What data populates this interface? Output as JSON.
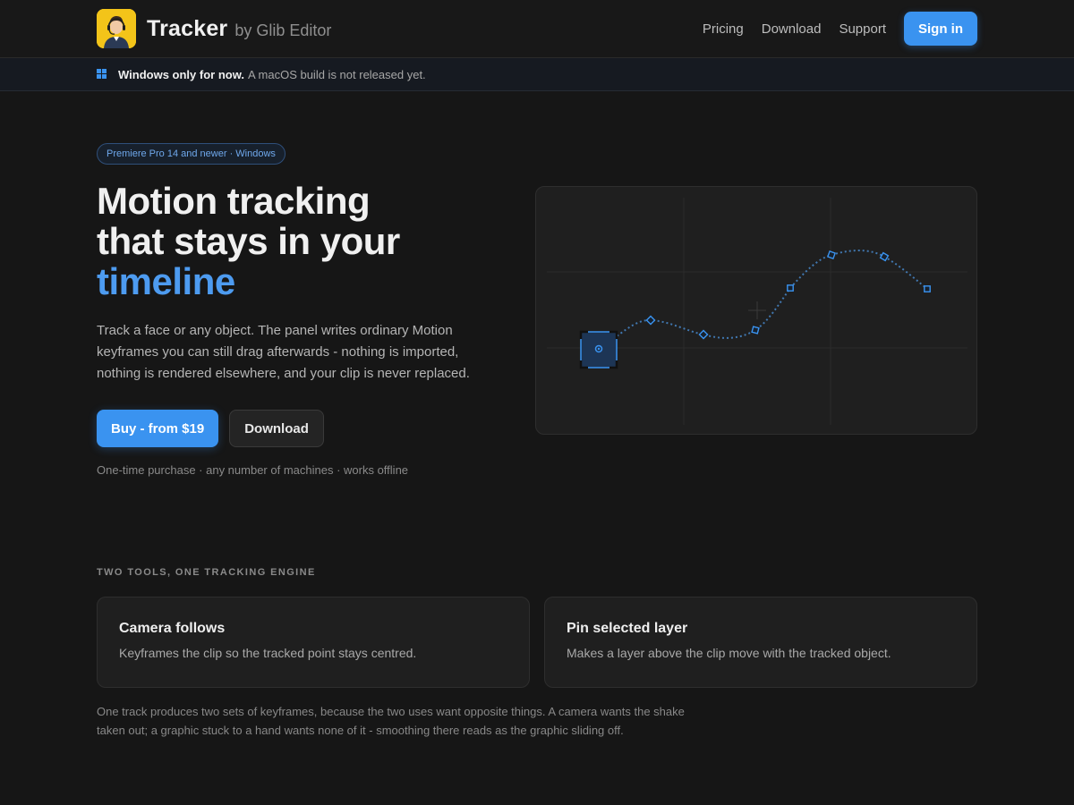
{
  "header": {
    "brand_name": "Tracker",
    "brand_by": "by Glib Editor",
    "nav": [
      "Pricing",
      "Download",
      "Support"
    ],
    "signin_label": "Sign in"
  },
  "notice": {
    "strong": "Windows only for now.",
    "text": "A macOS build is not released yet.",
    "icon": "windows-icon"
  },
  "hero": {
    "pill": "Premiere Pro 14 and newer · Windows",
    "headline_line1": "Motion tracking",
    "headline_line2": "that stays in your",
    "headline_accent": "timeline",
    "lead": "Track a face or any object. The panel writes ordinary Motion keyframes you can still drag afterwards - nothing is imported, nothing is rendered elsewhere, and your clip is never replaced.",
    "buy_label": "Buy - from $19",
    "download_label": "Download",
    "fineprint": "One-time purchase · any number of machines · works offline"
  },
  "tools": {
    "section_label": "TWO TOOLS, ONE TRACKING ENGINE",
    "cards": [
      {
        "title": "Camera follows",
        "text": "Keyframes the clip so the tracked point stays centred."
      },
      {
        "title": "Pin selected layer",
        "text": "Makes a layer above the clip move with the tracked object."
      }
    ],
    "footnote": "One track produces two sets of keyframes, because the two uses want opposite things. A camera wants the shake taken out; a graphic stuck to a hand wants none of it - smoothing there reads as the graphic sliding off."
  },
  "colors": {
    "accent": "#3a93f0",
    "background": "#161616",
    "logo_bg": "#f3c419"
  }
}
